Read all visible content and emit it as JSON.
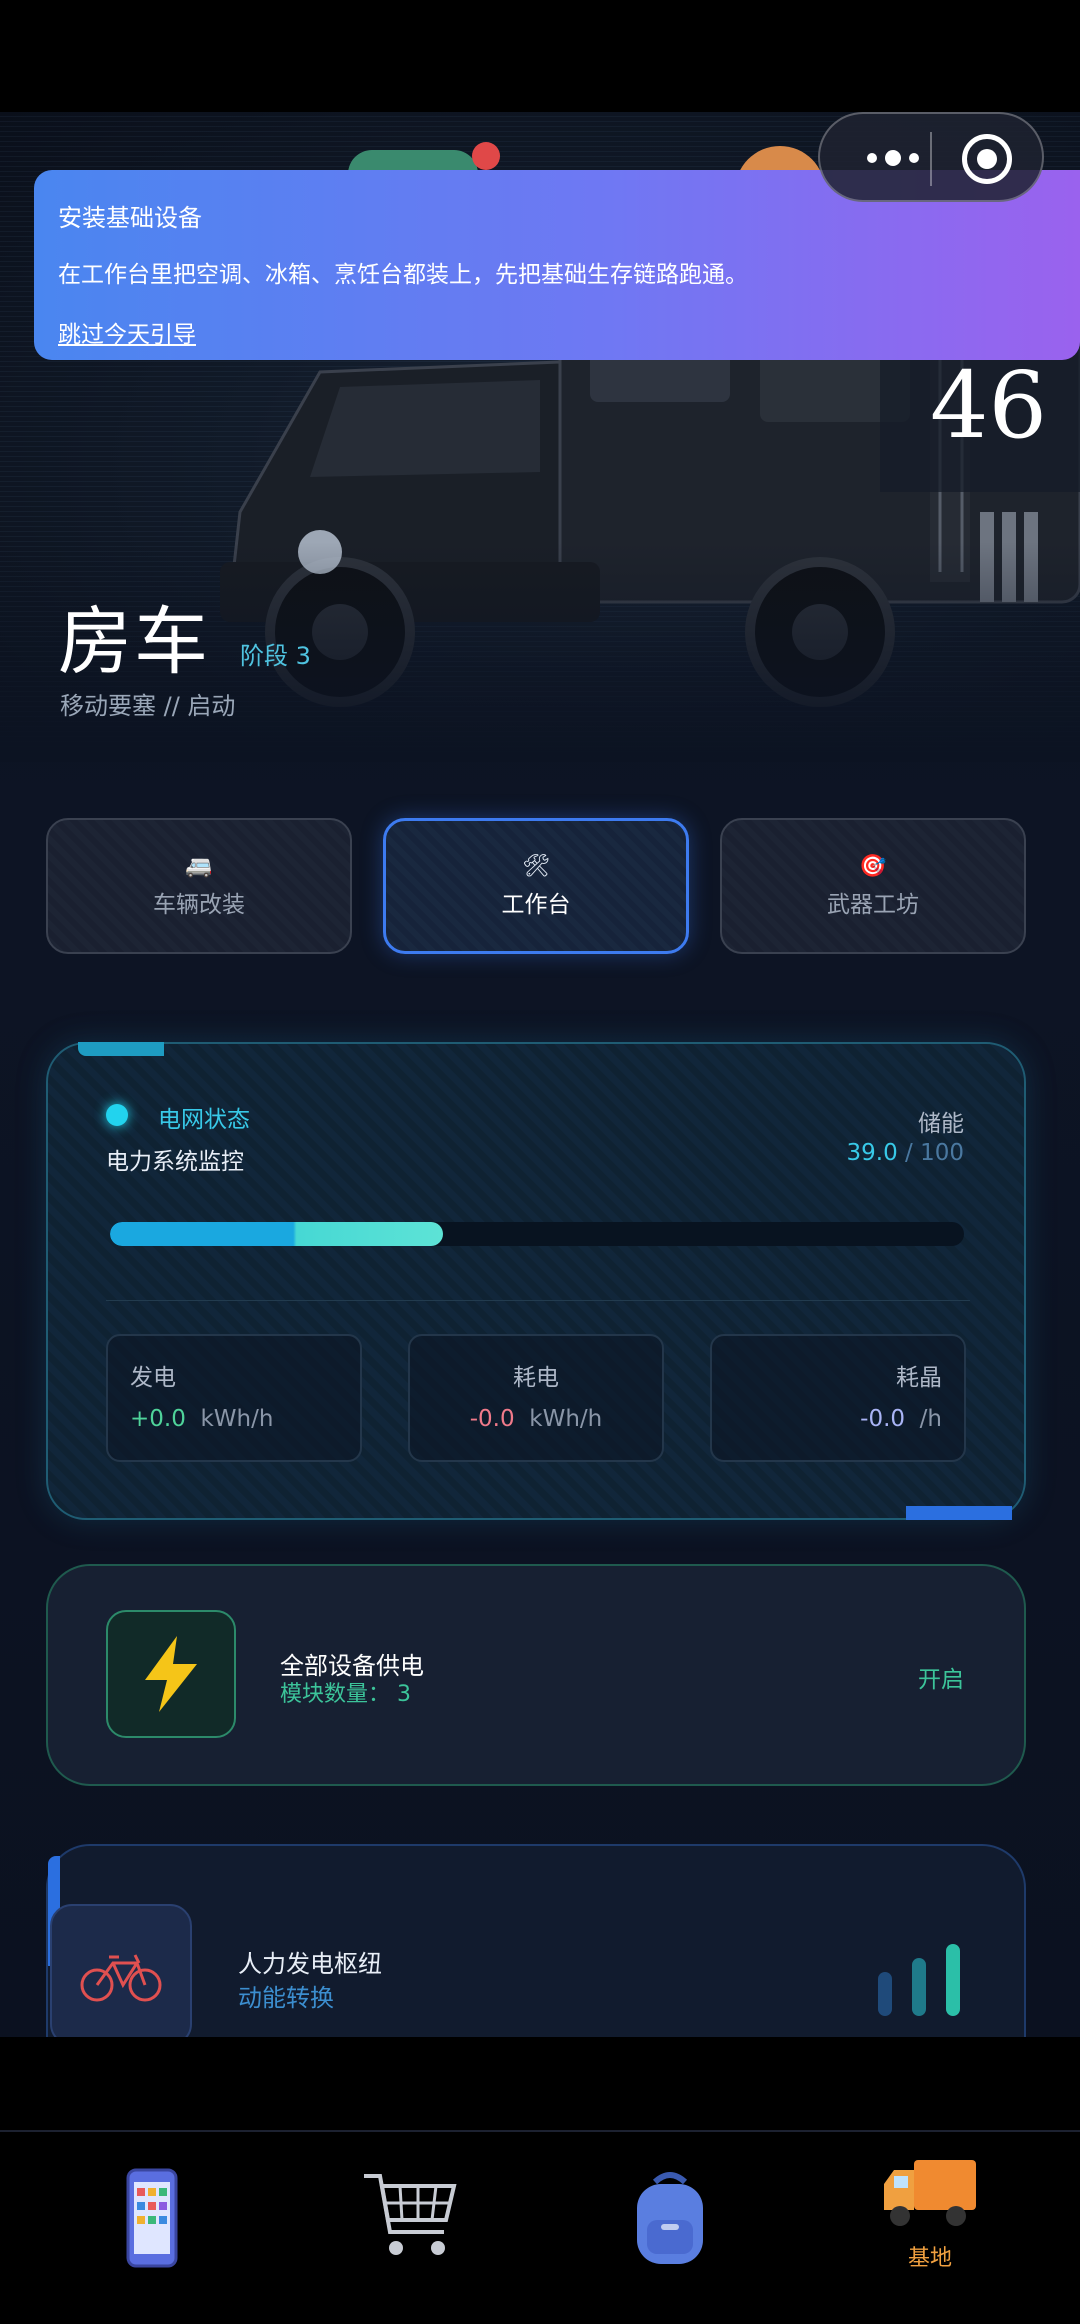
{
  "guide": {
    "title": "安装基础设备",
    "body": "在工作台里把空调、冰箱、烹饪台都装上，先把基础生存链路跑通。",
    "skip_label": "跳过今天引导"
  },
  "capsule": {
    "more_icon": "more-dots-icon",
    "close_icon": "target-close-icon"
  },
  "hero": {
    "level": "46",
    "title": "房车",
    "stage": "阶段 3",
    "subtitle": "移动要塞 // 启动"
  },
  "tabs": [
    {
      "icon": "🚐",
      "label": "车辆改装",
      "active": false
    },
    {
      "icon": "🛠",
      "label": "工作台",
      "active": true
    },
    {
      "icon": "🎯",
      "label": "武器工坊",
      "active": false
    }
  ],
  "power": {
    "grid_label": "电网状态",
    "subtitle": "电力系统监控",
    "storage_label": "储能",
    "storage_current": "39.0",
    "storage_separator": " / ",
    "storage_max": "100",
    "storage_fraction": 0.39,
    "stats": [
      {
        "label": "发电",
        "value": "+0.0",
        "unit": "kWh/h",
        "color": "#4fd39a"
      },
      {
        "label": "耗电",
        "value": "-0.0",
        "unit": "kWh/h",
        "color": "#f07a8a"
      },
      {
        "label": "耗晶",
        "value": "-0.0",
        "unit": "/h",
        "color": "#a9b4f5"
      }
    ]
  },
  "supply": {
    "title": "全部设备供电",
    "count_label": "模块数量：",
    "count": "3",
    "toggle_label": "开启"
  },
  "human_generator": {
    "title": "人力发电枢纽",
    "subtitle": "动能转换",
    "icon": "bicycle-icon"
  },
  "bottom_nav": [
    {
      "icon": "phone-icon",
      "label": ""
    },
    {
      "icon": "shopping-cart-icon",
      "label": ""
    },
    {
      "icon": "backpack-icon",
      "label": ""
    },
    {
      "icon": "truck-icon",
      "label": "基地",
      "active": true
    }
  ],
  "colors": {
    "accent": "#3d7bf0",
    "cyan": "#22d3ee",
    "green": "#3cc49a",
    "nav_active": "#f0a040"
  }
}
